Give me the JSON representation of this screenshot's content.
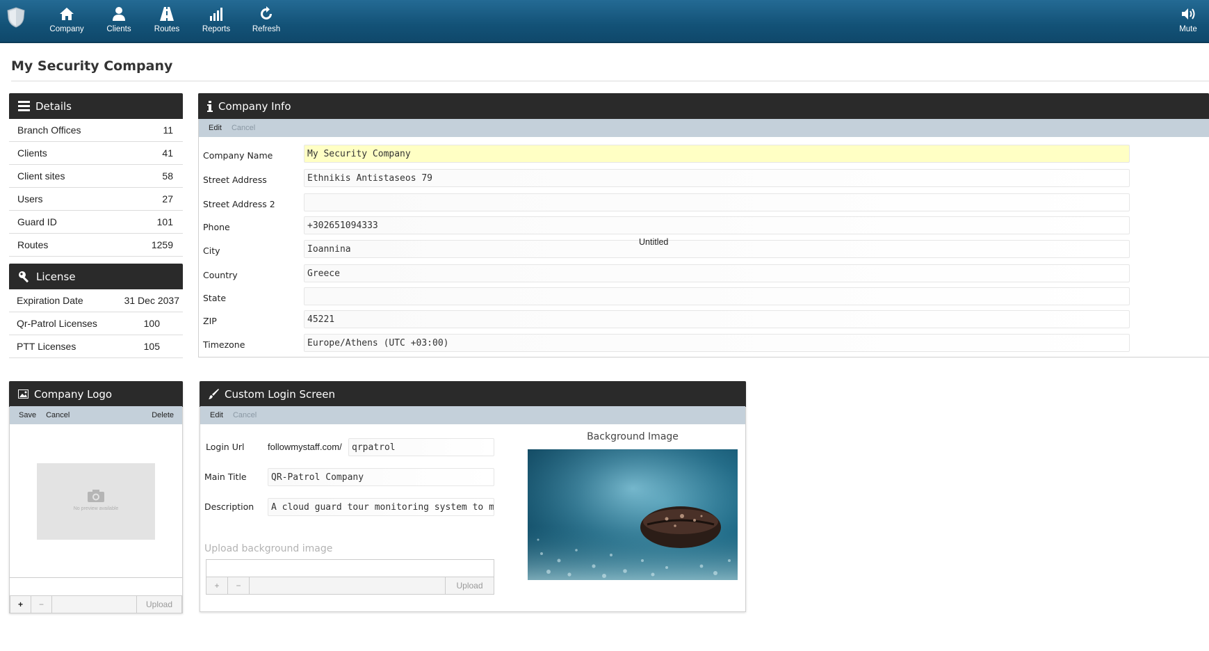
{
  "nav": {
    "items": [
      {
        "label": "Company",
        "icon": "home-icon"
      },
      {
        "label": "Clients",
        "icon": "user-icon"
      },
      {
        "label": "Routes",
        "icon": "road-icon"
      },
      {
        "label": "Reports",
        "icon": "bar-chart-icon"
      },
      {
        "label": "Refresh",
        "icon": "refresh-icon"
      }
    ],
    "mute_label": "Mute"
  },
  "page": {
    "title": "My Security Company",
    "overlay_label": "Untitled"
  },
  "details": {
    "title": "Details",
    "rows": [
      {
        "label": "Branch Offices",
        "value": "11"
      },
      {
        "label": "Clients",
        "value": "41"
      },
      {
        "label": "Client sites",
        "value": "58"
      },
      {
        "label": "Users",
        "value": "27"
      },
      {
        "label": "Guard ID",
        "value": "101"
      },
      {
        "label": "Routes",
        "value": "1259"
      }
    ]
  },
  "license": {
    "title": "License",
    "rows": [
      {
        "label": "Expiration Date",
        "value": "31 Dec 2037"
      },
      {
        "label": "Qr-Patrol Licenses",
        "value": "100"
      },
      {
        "label": "PTT Licenses",
        "value": "105"
      }
    ]
  },
  "company_info": {
    "title": "Company Info",
    "edit_label": "Edit",
    "cancel_label": "Cancel",
    "fields": [
      {
        "label": "Company Name",
        "value": "My Security Company"
      },
      {
        "label": "Street Address",
        "value": "Ethnikis Antistaseos 79"
      },
      {
        "label": "Street Address 2",
        "value": ""
      },
      {
        "label": "Phone",
        "value": "+302651094333"
      },
      {
        "label": "City",
        "value": "Ioannina"
      },
      {
        "label": "Country",
        "value": "Greece"
      },
      {
        "label": "State",
        "value": ""
      },
      {
        "label": "ZIP",
        "value": "45221"
      },
      {
        "label": "Timezone",
        "value": "Europe/Athens (UTC +03:00)"
      }
    ]
  },
  "logo_panel": {
    "title": "Company Logo",
    "save_label": "Save",
    "cancel_label": "Cancel",
    "delete_label": "Delete",
    "no_preview": "No preview available",
    "add_label": "+",
    "remove_label": "−",
    "upload_label": "Upload"
  },
  "login_screen": {
    "title": "Custom Login Screen",
    "edit_label": "Edit",
    "cancel_label": "Cancel",
    "login_url_label": "Login Url",
    "login_url_prefix": "followmystaff.com/",
    "login_url_value": "qrpatrol",
    "main_title_label": "Main Title",
    "main_title_value": "QR-Patrol Company",
    "description_label": "Description",
    "description_value": "A cloud guard tour monitoring system to manage",
    "upload_bg_label": "Upload background image",
    "add_label": "+",
    "remove_label": "−",
    "upload_label": "Upload",
    "bg_image_label": "Background Image"
  },
  "colors": {
    "topbar": "#135277",
    "panel_header": "#2a2a2a",
    "subbar": "#c4d0da",
    "highlight_input": "#ffffc4"
  }
}
